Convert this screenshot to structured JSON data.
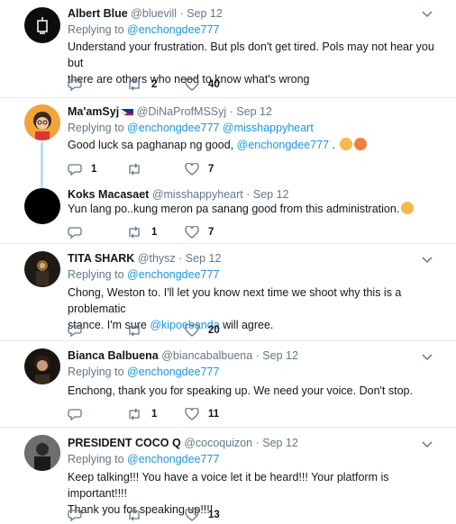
{
  "tweets": [
    {
      "name": "Albert Blue",
      "handle": "@bluevill",
      "dot_date": "· Sep 12",
      "replying_prefix": "Replying to",
      "replying_mentions": [
        "@enchongdee777"
      ],
      "text_lines": [
        "Understand your frustration.  But pls don't get tired. Pols may not hear you but",
        "there are others who need to know what's wrong"
      ],
      "reply_count": "",
      "retweet_count": "2",
      "like_count": "40"
    },
    {
      "name": "Ma'amSyj",
      "handle": "@DiNaProfMSSyj",
      "dot_date": "· Sep 12",
      "replying_prefix": "Replying to",
      "replying_mentions": [
        "@enchongdee777",
        "@misshappyheart"
      ],
      "text_before": "Good luck sa paghanap ng good, ",
      "text_mention": "@enchongdee777",
      "text_after": " .",
      "reply_count": "1",
      "retweet_count": "",
      "like_count": "7"
    },
    {
      "name": "Koks Macasaet",
      "handle": "@misshappyheart",
      "dot_date": "· Sep 12",
      "text_lines": [
        "Yun lang po..kung meron pa sanang good from this administration."
      ],
      "reply_count": "",
      "retweet_count": "1",
      "like_count": "7"
    },
    {
      "name": "TITA SHARK",
      "handle": "@thysz",
      "dot_date": "· Sep 12",
      "replying_prefix": "Replying to",
      "replying_mentions": [
        "@enchongdee777"
      ],
      "text_lines": [
        "Chong, Weston to. I'll let you know next time we shoot why this is a problematic"
      ],
      "text2_before": "stance. I'm sure ",
      "text2_mention": "@kipoebanda",
      "text2_after": " will agree.",
      "reply_count": "",
      "retweet_count": "",
      "like_count": "20"
    },
    {
      "name": "Bianca Balbuena",
      "handle": "@biancabalbuena",
      "dot_date": "· Sep 12",
      "replying_prefix": "Replying to",
      "replying_mentions": [
        "@enchongdee777"
      ],
      "text_lines": [
        "Enchong, thank you for speaking up. We need your voice. Don't stop."
      ],
      "reply_count": "",
      "retweet_count": "1",
      "like_count": "11"
    },
    {
      "name": "PRESIDENT COCO Q",
      "handle": "@cocoquizon",
      "dot_date": "· Sep 12",
      "replying_prefix": "Replying to",
      "replying_mentions": [
        "@enchongdee777"
      ],
      "text_lines": [
        "Keep talking!!! You have a voice let it be heard!!! Your platform is important!!!!",
        "Thank you for speaking up!!!!"
      ],
      "reply_count": "",
      "retweet_count": "",
      "like_count": "13"
    }
  ],
  "icons": {
    "reply": "reply-icon",
    "retweet": "retweet-icon",
    "like": "heart-icon",
    "menu": "chevron-down-icon"
  },
  "colors": {
    "link": "#1b95e0",
    "muted": "#657786",
    "text": "#14171a",
    "thread_line": "#b9dbf2",
    "divider": "#e6ecf0"
  }
}
